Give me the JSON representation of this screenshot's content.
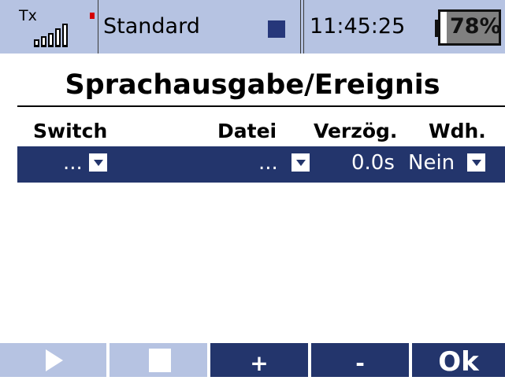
{
  "status": {
    "tx_label": "Tx",
    "model_name": "Standard",
    "time": "11:45:25",
    "battery_percent": "78%",
    "battery_level": 0.78,
    "signal_icon": "signal-bars-icon",
    "colors": {
      "bar_bg": "#b6c3e2",
      "accent": "#26377a",
      "alert": "#d40000"
    }
  },
  "page": {
    "title": "Sprachausgabe/Ereignis"
  },
  "table": {
    "headers": {
      "switch": "Switch",
      "file": "Datei",
      "delay": "Verzög.",
      "repeat": "Wdh."
    },
    "rows": [
      {
        "switch": "...",
        "file": "...",
        "delay": "0.0s",
        "repeat": "Nein"
      }
    ],
    "row_color": "#23356c"
  },
  "toolbar": {
    "play_icon": "play-icon",
    "stop_icon": "stop-icon",
    "add_label": "+",
    "remove_label": "-",
    "ok_label": "Ok",
    "colors": {
      "disabled": "#b6c3e2",
      "enabled": "#23356c"
    }
  }
}
